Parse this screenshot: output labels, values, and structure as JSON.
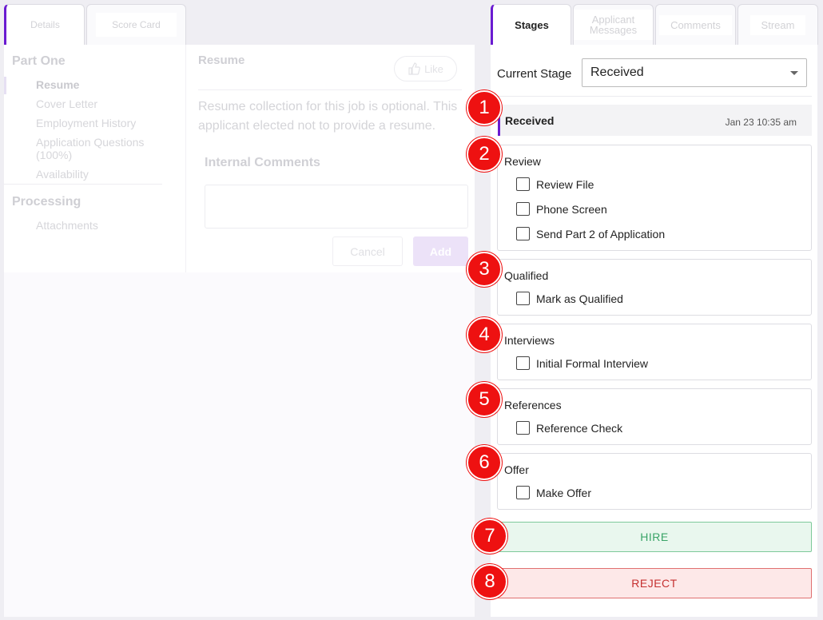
{
  "left_tabs": [
    {
      "label": "Details",
      "active": true
    },
    {
      "label": "Score Card",
      "active": false
    }
  ],
  "nav": {
    "section1": "Part One",
    "items1": [
      "Resume",
      "Cover Letter",
      "Employment History",
      "Application Questions (100%)",
      "Availability"
    ],
    "section2": "Processing",
    "items2": [
      "Attachments"
    ]
  },
  "resume": {
    "title": "Resume",
    "like_label": "Like",
    "text": "Resume collection for this job is optional. This applicant elected not to provide a resume.",
    "comments_title": "Internal Comments",
    "cancel_label": "Cancel",
    "add_label": "Add"
  },
  "right_tabs": [
    {
      "label": "Stages",
      "active": true
    },
    {
      "label": "Applicant Messages",
      "active": false
    },
    {
      "label": "Comments",
      "active": false
    },
    {
      "label": "Stream",
      "active": false
    }
  ],
  "current_stage": {
    "label": "Current Stage",
    "value": "Received"
  },
  "received": {
    "label": "Received",
    "date": "Jan 23 10:35 am"
  },
  "stages": [
    {
      "title": "Review",
      "checks": [
        "Review File",
        "Phone Screen",
        "Send Part 2 of Application"
      ]
    },
    {
      "title": "Qualified",
      "checks": [
        "Mark as Qualified"
      ]
    },
    {
      "title": "Interviews",
      "checks": [
        "Initial Formal Interview"
      ]
    },
    {
      "title": "References",
      "checks": [
        "Reference Check"
      ]
    },
    {
      "title": "Offer",
      "checks": [
        "Make Offer"
      ]
    }
  ],
  "actions": {
    "hire": "HIRE",
    "reject": "REJECT"
  },
  "markers": [
    "1",
    "2",
    "3",
    "4",
    "5",
    "6",
    "7",
    "8"
  ],
  "colors": {
    "accent": "#6a1bd1",
    "marker": "#ee1111",
    "hire": "#3aa468",
    "reject": "#c53030"
  }
}
